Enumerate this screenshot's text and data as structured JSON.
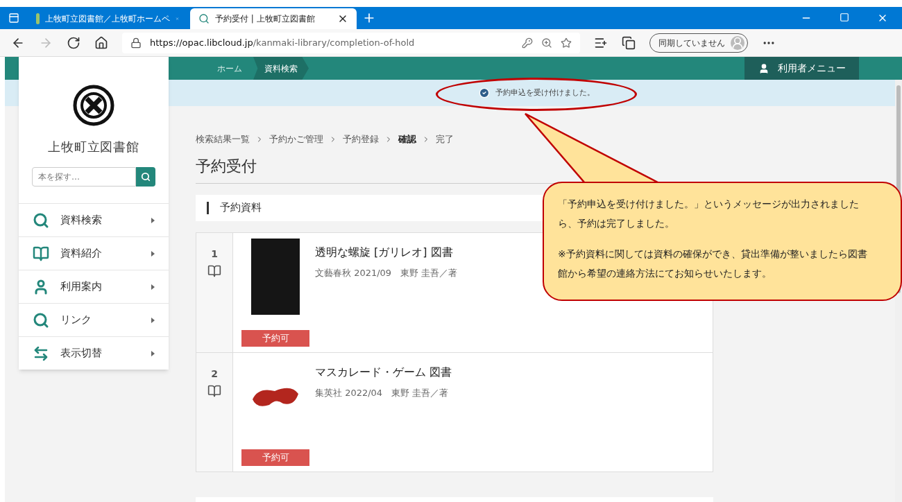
{
  "browser": {
    "tabs": [
      {
        "title": "上牧町立図書館／上牧町ホームペ",
        "selected": false,
        "kind": "town"
      },
      {
        "title": "予約受付 | 上牧町立図書館",
        "selected": true,
        "kind": "library"
      }
    ],
    "url_host": "https://opac.libcloud.jp",
    "url_path": "/kanmaki-library/completion-of-hold",
    "sync_label": "同期していません"
  },
  "site": {
    "nav": [
      {
        "label": "ホーム",
        "selected": false
      },
      {
        "label": "資料検索",
        "selected": true
      }
    ],
    "user_menu": "利用者メニュー",
    "notice": "予約申込を受け付けました。"
  },
  "sidebar": {
    "library_name": "上牧町立図書館",
    "search": {
      "placeholder": "本を探す…"
    },
    "items": [
      {
        "label": "資料検索",
        "kind": "search"
      },
      {
        "label": "資料紹介",
        "kind": "book"
      },
      {
        "label": "利用案内",
        "kind": "person"
      },
      {
        "label": "リンク",
        "kind": "search"
      },
      {
        "label": "表示切替",
        "kind": "swap"
      }
    ]
  },
  "page": {
    "breadcrumb": [
      {
        "label": "検索結果一覧",
        "current": false
      },
      {
        "label": "予約かご管理",
        "current": false
      },
      {
        "label": "予約登録",
        "current": false
      },
      {
        "label": "確認",
        "current": true
      },
      {
        "label": "完了",
        "current": false
      }
    ],
    "title": "予約受付",
    "section": "予約資料",
    "items": [
      {
        "number": "1",
        "title": "透明な螺旋 [ガリレオ] 図書",
        "meta": "文藝春秋 2021/09　東野 圭吾／著",
        "status": "予約可",
        "kind": "dark"
      },
      {
        "number": "2",
        "title": "マスカレード・ゲーム 図書",
        "meta": "集英社 2022/04　東野 圭吾／著",
        "status": "予約可",
        "kind": "mask"
      }
    ]
  },
  "callout": {
    "paragraphs": [
      "「予約申込を受け付けました。」というメッセージが出力されましたら、予約は完了しました。",
      "※予約資料に関しては資料の確保ができ、貸出準備が整いましたら図書館から希望の連絡方法にてお知らせいたします。"
    ]
  }
}
